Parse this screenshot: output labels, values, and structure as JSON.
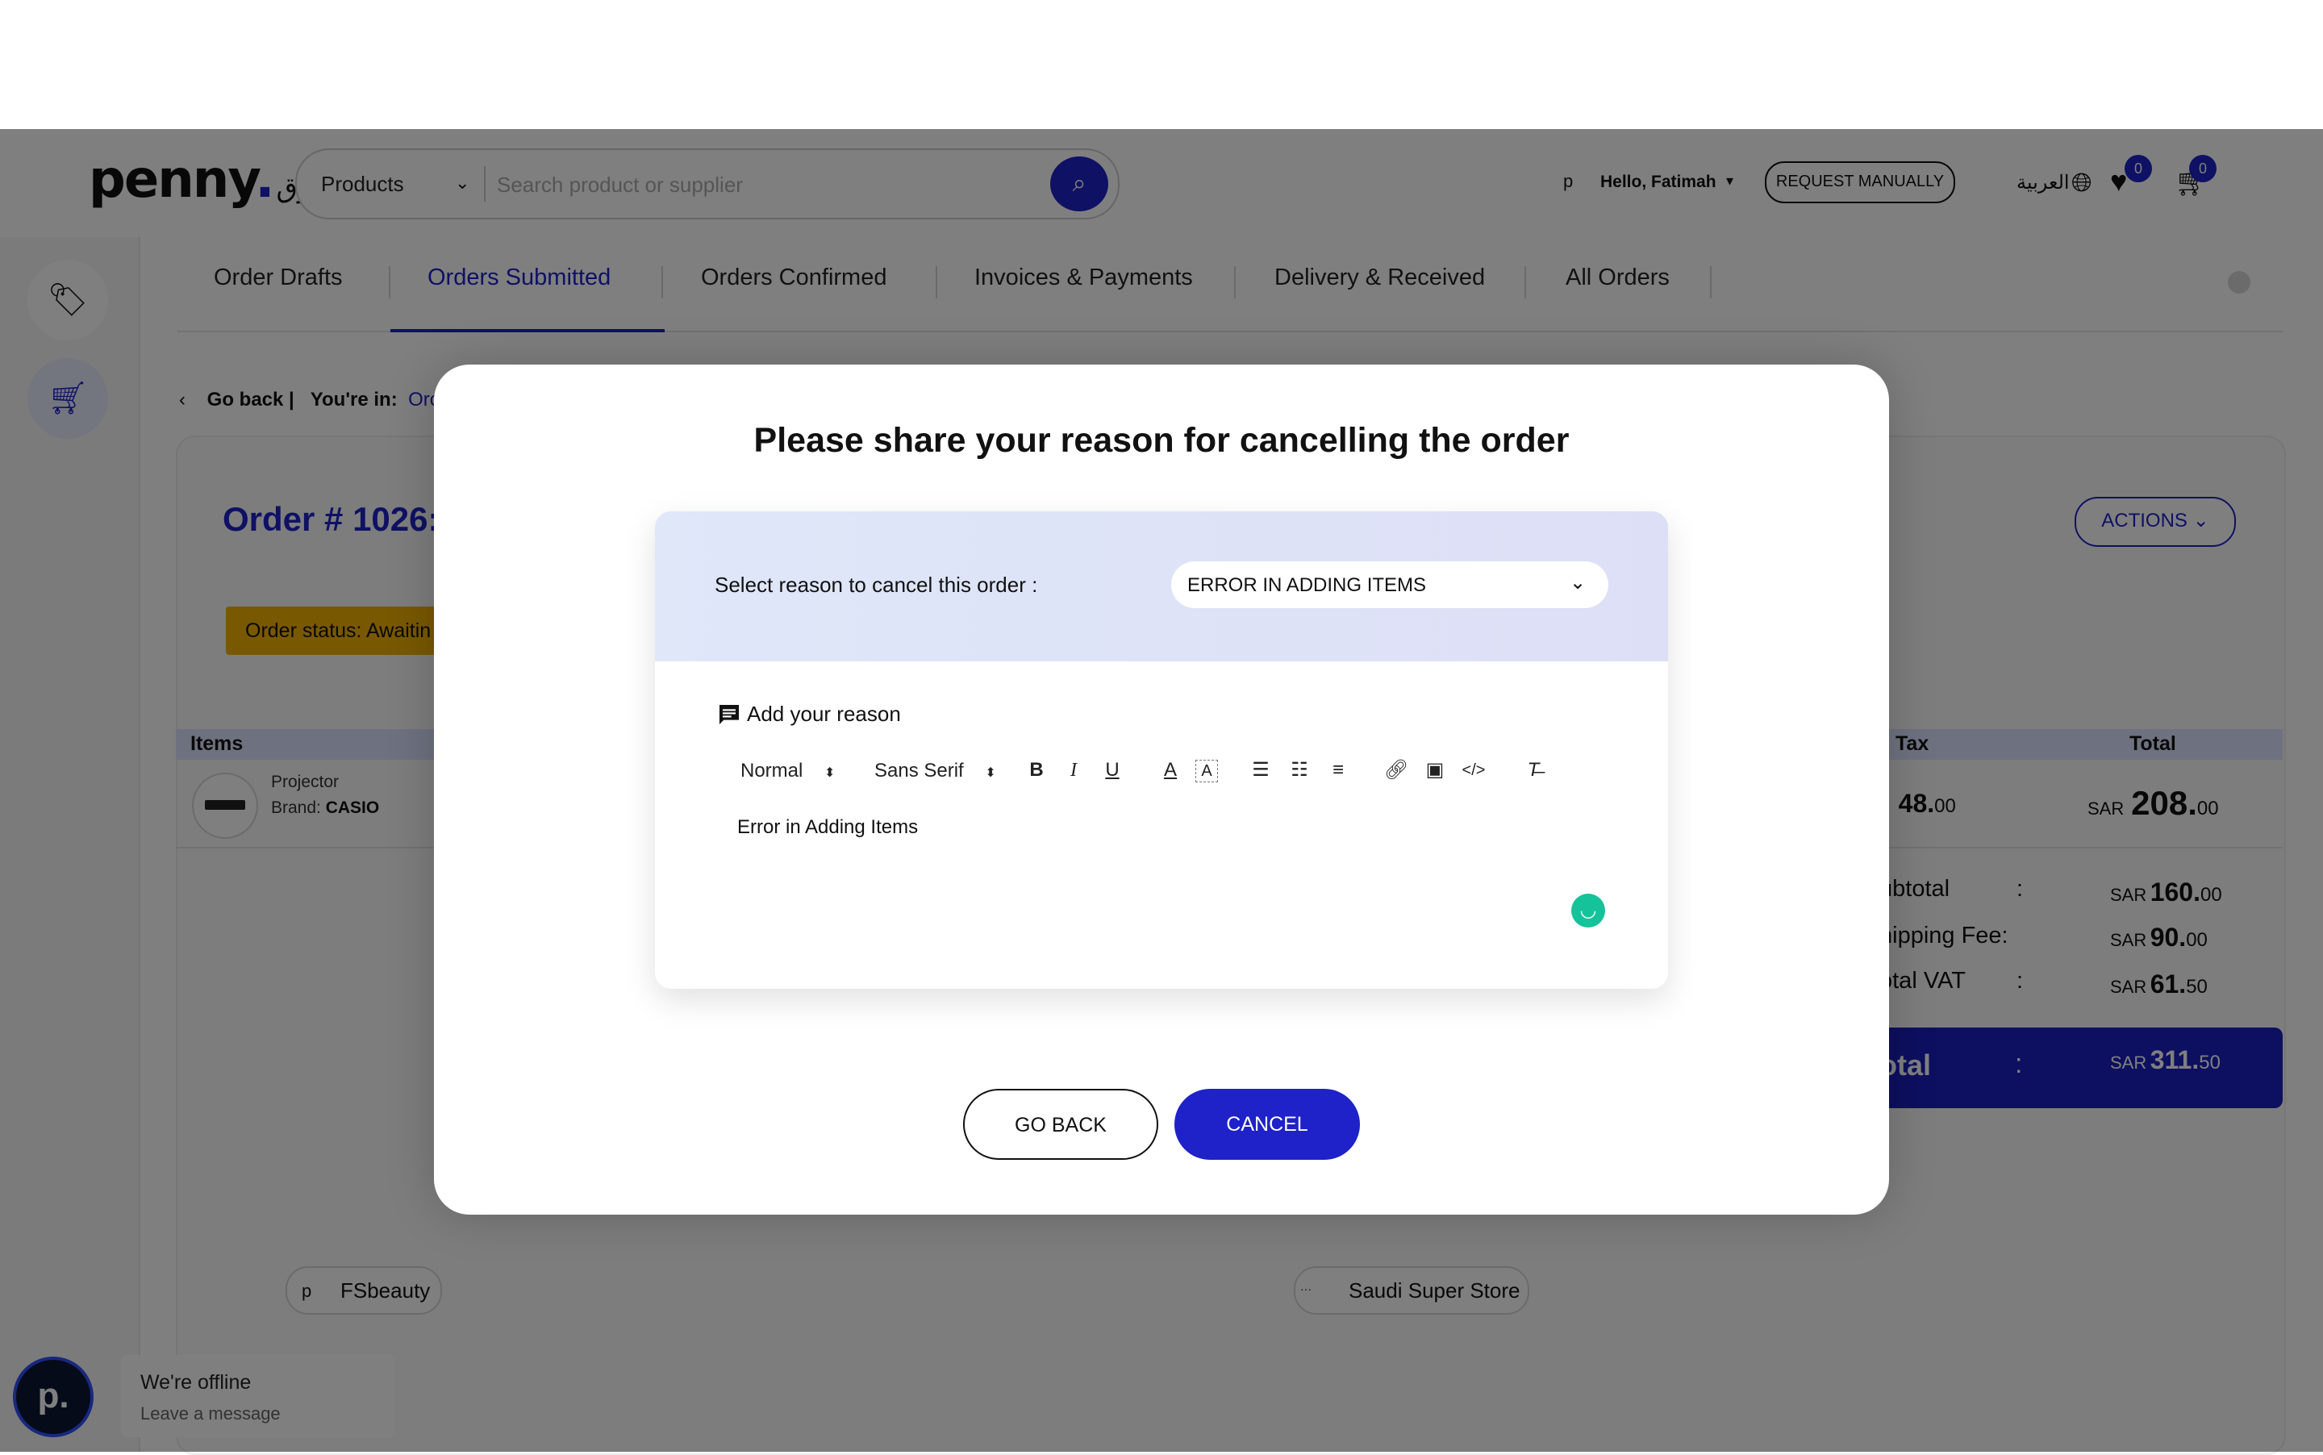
{
  "header": {
    "logo": "penny",
    "logo_arabic": "سوق",
    "category_select": "Products",
    "search_placeholder": "Search product or supplier",
    "user_initial": "p",
    "greeting": "Hello, Fatimah",
    "request_button": "REQUEST MANUALLY",
    "language": "العربية",
    "wishlist_count": "0",
    "cart_count": "0"
  },
  "tabs": [
    "Order Drafts",
    "Orders Submitted",
    "Orders Confirmed",
    "Invoices & Payments",
    "Delivery & Received",
    "All Orders"
  ],
  "active_tab": "Orders Submitted",
  "breadcrumb": {
    "back": "Go back",
    "sep": "|",
    "prefix": "You're in:",
    "current": "Orc"
  },
  "order": {
    "title": "Order # 1026:",
    "actions_label": "ACTIONS",
    "status": "Order status: Awaitin"
  },
  "table": {
    "headers": {
      "items": "Items",
      "tax": "Tax",
      "total": "Total"
    },
    "rows": [
      {
        "name": "Projector",
        "brand_label": "Brand:",
        "brand": "CASIO",
        "tax_prefix": "R",
        "tax_int": "48.",
        "tax_cents": "00",
        "total_currency": "SAR",
        "total_int": "208.",
        "total_cents": "00"
      }
    ]
  },
  "summary": {
    "subtotal_label": "ubtotal",
    "subtotal_currency": "SAR",
    "subtotal_int": "160.",
    "subtotal_cents": "00",
    "shipping_label": "hipping Fee:",
    "shipping_currency": "SAR",
    "shipping_int": "90.",
    "shipping_cents": "00",
    "vat_label": "otal VAT",
    "vat_currency": "SAR",
    "vat_int": "61.",
    "vat_cents": "50",
    "colon": ":",
    "grand_label": "otal",
    "grand_currency": "SAR",
    "grand_int": "311.",
    "grand_cents": "50"
  },
  "suppliers": [
    {
      "icon": "p",
      "name": "FSbeauty"
    },
    {
      "icon": "···",
      "name": "Saudi Super Store"
    }
  ],
  "chat": {
    "avatar": "p.",
    "title": "We're offline",
    "subtitle": "Leave a message"
  },
  "modal": {
    "title": "Please share your reason for cancelling the order",
    "select_label": "Select reason to cancel this order :",
    "selected_reason": "ERROR IN ADDING ITEMS",
    "add_reason_label": "Add your reason",
    "toolbar": {
      "format": "Normal",
      "font": "Sans Serif"
    },
    "editor_text": "Error in Adding Items",
    "go_back": "GO BACK",
    "cancel": "CANCEL"
  },
  "colors": {
    "brand": "#1e22c8",
    "status": "#f0b100",
    "grammarly": "#15c39a"
  }
}
